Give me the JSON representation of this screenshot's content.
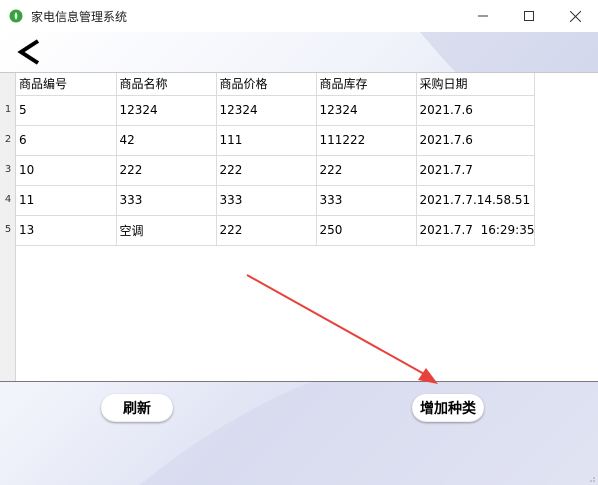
{
  "window": {
    "title": "家电信息管理系统",
    "accent": "#3aa23a"
  },
  "toolbar": {
    "back_icon": "chevron-left-icon"
  },
  "table": {
    "columns": [
      "商品编号",
      "商品名称",
      "商品价格",
      "商品库存",
      "采购日期"
    ],
    "rows": [
      {
        "num": "1",
        "cells": [
          "5",
          "12324",
          "12324",
          "12324",
          "2021.7.6"
        ]
      },
      {
        "num": "2",
        "cells": [
          "6",
          "42",
          "111",
          "111222",
          "2021.7.6"
        ]
      },
      {
        "num": "3",
        "cells": [
          "10",
          "222",
          "222",
          "222",
          "2021.7.7"
        ]
      },
      {
        "num": "4",
        "cells": [
          "11",
          "333",
          "333",
          "333",
          "2021.7.7.14.58.51"
        ]
      },
      {
        "num": "5",
        "cells": [
          "13",
          "空调",
          "222",
          "250",
          "2021.7.7  16:29:35"
        ]
      }
    ]
  },
  "actions": {
    "refresh_label": "刷新",
    "add_category_label": "增加种类"
  },
  "annotation": {
    "arrow_color": "#e8403a"
  }
}
